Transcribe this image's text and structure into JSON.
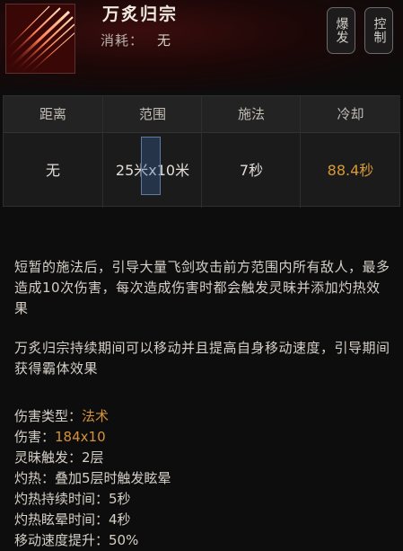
{
  "skill": {
    "name": "万炙归宗",
    "cost_label": "消耗：",
    "cost_value": "无",
    "icon": "flying-swords-icon"
  },
  "buttons": [
    {
      "label": "爆发"
    },
    {
      "label": "控制"
    }
  ],
  "stats": {
    "headers": [
      "距离",
      "范围",
      "施法",
      "冷却"
    ],
    "values": [
      "无",
      "25米x10米",
      "7秒",
      "88.4秒"
    ]
  },
  "description": {
    "para1": "短暂的施法后，引导大量飞剑攻击前方范围内所有敌人，最多造成10次伤害，每次造成伤害时都会触发灵昧并添加灼热效果",
    "para2": "万炙归宗持续期间可以移动并且提高自身移动速度，引导期间获得霸体效果"
  },
  "attributes": [
    {
      "key": "伤害类型：",
      "value": "法术"
    },
    {
      "key": "伤害：",
      "value": "184x10"
    },
    {
      "key": "灵昧触发：",
      "value": "2层"
    },
    {
      "key": "灼热：",
      "value": "叠加5层时触发眩晕"
    },
    {
      "key": "灼热持续时间：",
      "value": "5秒"
    },
    {
      "key": "灼热眩晕时间：",
      "value": "4秒"
    },
    {
      "key": "移动速度提升：",
      "value": "50%"
    }
  ],
  "colors": {
    "accent_orange": "#d4923a",
    "background": "#0e0d0d",
    "header_red": "#5e0c0c"
  }
}
